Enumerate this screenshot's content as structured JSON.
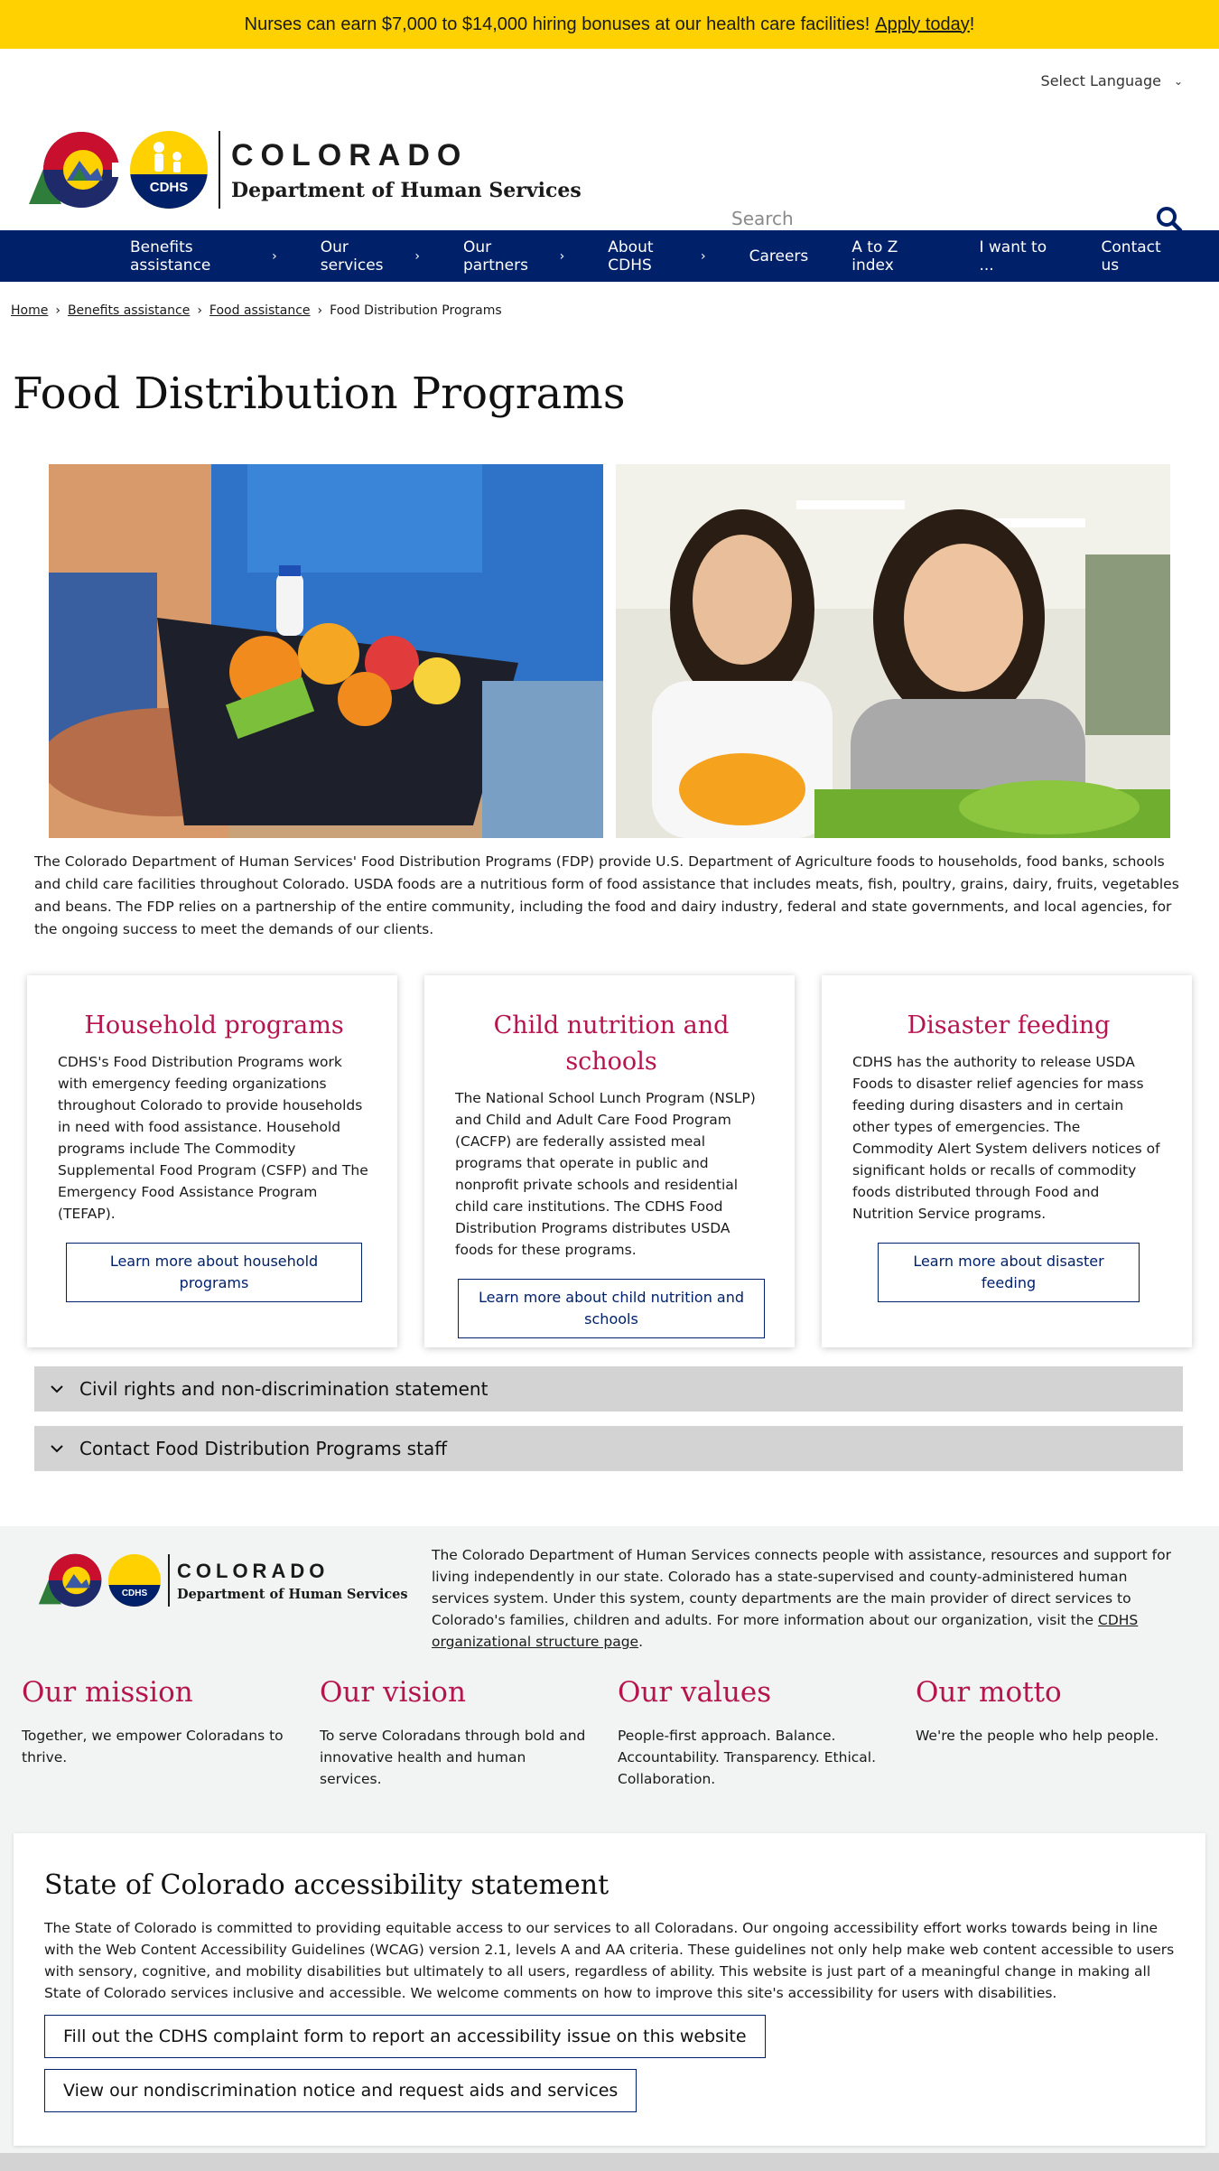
{
  "alert": {
    "text": "Nurses can earn $7,000 to $14,000 hiring bonuses at our health care facilities!",
    "link": "Apply today",
    "suffix": "!"
  },
  "header": {
    "language_label": "Select Language",
    "brand_name": "COLORADO",
    "brand_dept": "Department of Human Services",
    "cdhs_badge": "CDHS",
    "search_placeholder": "Search"
  },
  "nav": {
    "items": [
      {
        "label": "Benefits assistance",
        "has_arrow": true
      },
      {
        "label": "Our services",
        "has_arrow": true
      },
      {
        "label": "Our partners",
        "has_arrow": true
      },
      {
        "label": "About CDHS",
        "has_arrow": true
      },
      {
        "label": "Careers",
        "has_arrow": false
      },
      {
        "label": "A to Z index",
        "has_arrow": false
      },
      {
        "label": "I want to ...",
        "has_arrow": false
      },
      {
        "label": "Contact us",
        "has_arrow": false
      }
    ]
  },
  "breadcrumb": {
    "items": [
      "Home",
      "Benefits assistance",
      "Food assistance"
    ],
    "current": "Food Distribution Programs"
  },
  "page": {
    "title": "Food Distribution Programs",
    "intro": "The Colorado Department of Human Services' Food Distribution Programs (FDP) provide U.S. Department of Agriculture foods to households, food banks, schools and child care facilities throughout Colorado. USDA foods are a nutritious form of food assistance that includes meats, fish, poultry, grains, dairy, fruits, vegetables and beans. The FDP relies on a partnership of the entire community, including the food and dairy industry, federal and state governments, and local agencies, for the ongoing success to meet the demands of our clients."
  },
  "cards": [
    {
      "title": "Household programs",
      "body": "CDHS's Food Distribution Programs work with emergency feeding organizations throughout Colorado to provide households in need with food assistance. Household programs include The Commodity Supplemental Food Program (CSFP) and The Emergency Food Assistance Program (TEFAP).",
      "button": "Learn more about household programs"
    },
    {
      "title": "Child nutrition and schools",
      "body": "The National School Lunch Program (NSLP) and Child and Adult Care Food Program (CACFP) are federally assisted meal programs that operate in public and nonprofit private schools and residential child care institutions. The CDHS Food Distribution Programs distributes USDA foods for these programs.",
      "button": "Learn more about child nutrition and schools"
    },
    {
      "title": "Disaster feeding",
      "body": "CDHS has the authority to release USDA Foods to disaster relief agencies for mass feeding during disasters and in certain other types of emergencies. The Commodity Alert System delivers notices of significant holds or recalls of commodity foods distributed through Food and Nutrition Service programs.",
      "button": "Learn more about disaster feeding"
    }
  ],
  "accordions": [
    "Civil rights and non-discrimination statement",
    "Contact Food Distribution Programs staff"
  ],
  "footer": {
    "about": "The Colorado Department of Human Services connects people with assistance, resources and support for living independently in our state. Colorado has a state-supervised and county-administered human services system. Under this system, county departments are the main provider of direct services to Colorado's families, children and adults. For more information about our organization, visit the",
    "about_link": "CDHS organizational structure page",
    "pillars": [
      {
        "title": "Our mission",
        "text": "Together, we empower Coloradans to thrive."
      },
      {
        "title": "Our vision",
        "text": "To serve Coloradans through bold and innovative health and human services."
      },
      {
        "title": "Our values",
        "text": "People-first approach. Balance. Accountability. Transparency. Ethical. Collaboration."
      },
      {
        "title": "Our motto",
        "text": "We're the people who help people."
      }
    ]
  },
  "accessibility": {
    "title": "State of Colorado accessibility statement",
    "body": "The State of Colorado is committed to providing equitable access to our services to all Coloradans. Our ongoing accessibility effort works towards being in line with the Web Content Accessibility Guidelines (WCAG) version 2.1, levels A and AA criteria. These guidelines not only help make web content accessible to users with sensory, cognitive, and mobility disabilities but ultimately to all users, regardless of ability. This website is just part of a meaningful change in making all State of Colorado services inclusive and accessible. We welcome comments on how to improve this site's accessibility for users with disabilities.",
    "button1": "Fill out the CDHS complaint form to report an accessibility issue on this website",
    "button2": "View our nondiscrimination notice and request aids and services"
  },
  "colors": {
    "alert": "#ffd100",
    "nav": "#002169",
    "accent": "#b5144c"
  }
}
